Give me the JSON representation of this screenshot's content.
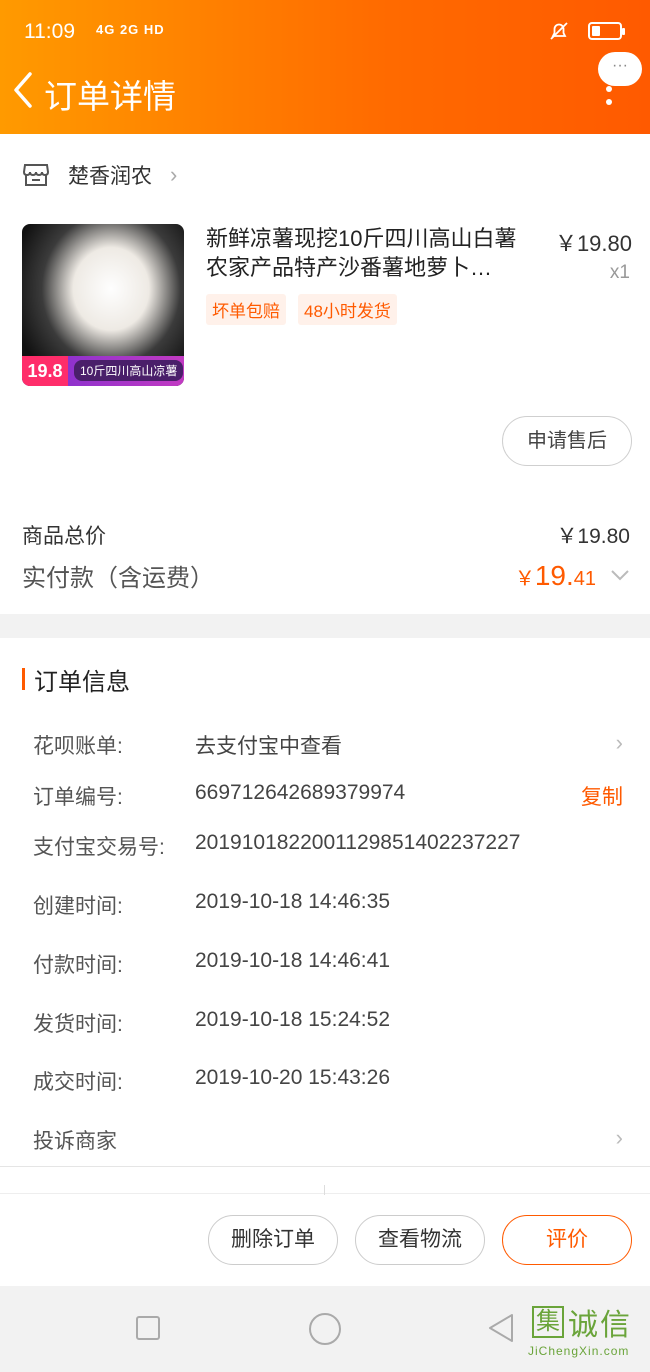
{
  "status": {
    "time": "11:09",
    "network": "4G 2G HD"
  },
  "header": {
    "title": "订单详情",
    "more_label": "···"
  },
  "shop": {
    "name": "楚香润农"
  },
  "product": {
    "title": "新鲜凉薯现挖10斤四川高山白薯农家产品特产沙番薯地萝卜…",
    "price": "￥19.80",
    "qty": "x1",
    "tags": [
      "坏单包赔",
      "48小时发货"
    ],
    "thumb_price": "19.8",
    "thumb_caption": "10斤四川高山凉薯"
  },
  "after_sale_label": "申请售后",
  "summary": {
    "total_label": "商品总价",
    "total_value": "￥19.80",
    "paid_label": "实付款（含运费）",
    "paid_symbol": "￥",
    "paid_int": "19.",
    "paid_dec": "41"
  },
  "order_info": {
    "title": "订单信息",
    "rows": [
      {
        "label": "花呗账单:",
        "value": "去支付宝中查看"
      },
      {
        "label": "订单编号:",
        "value": "669712642689379974",
        "action": "复制"
      },
      {
        "label": "支付宝交易号:",
        "value": "2019101822001129851402237227"
      },
      {
        "label": "创建时间:",
        "value": "2019-10-18 14:46:35"
      },
      {
        "label": "付款时间:",
        "value": "2019-10-18 14:46:41"
      },
      {
        "label": "发货时间:",
        "value": "2019-10-18 15:24:52"
      },
      {
        "label": "成交时间:",
        "value": "2019-10-20 15:43:26"
      }
    ],
    "complaint_label": "投诉商家"
  },
  "actions": {
    "delete": "删除订单",
    "logistics": "查看物流",
    "review": "评价"
  },
  "watermark": {
    "char": "集",
    "text": "诚信",
    "sub": "JiChengXin.com"
  },
  "colors": {
    "accent": "#ff5a00",
    "header_start": "#ff9a00"
  }
}
